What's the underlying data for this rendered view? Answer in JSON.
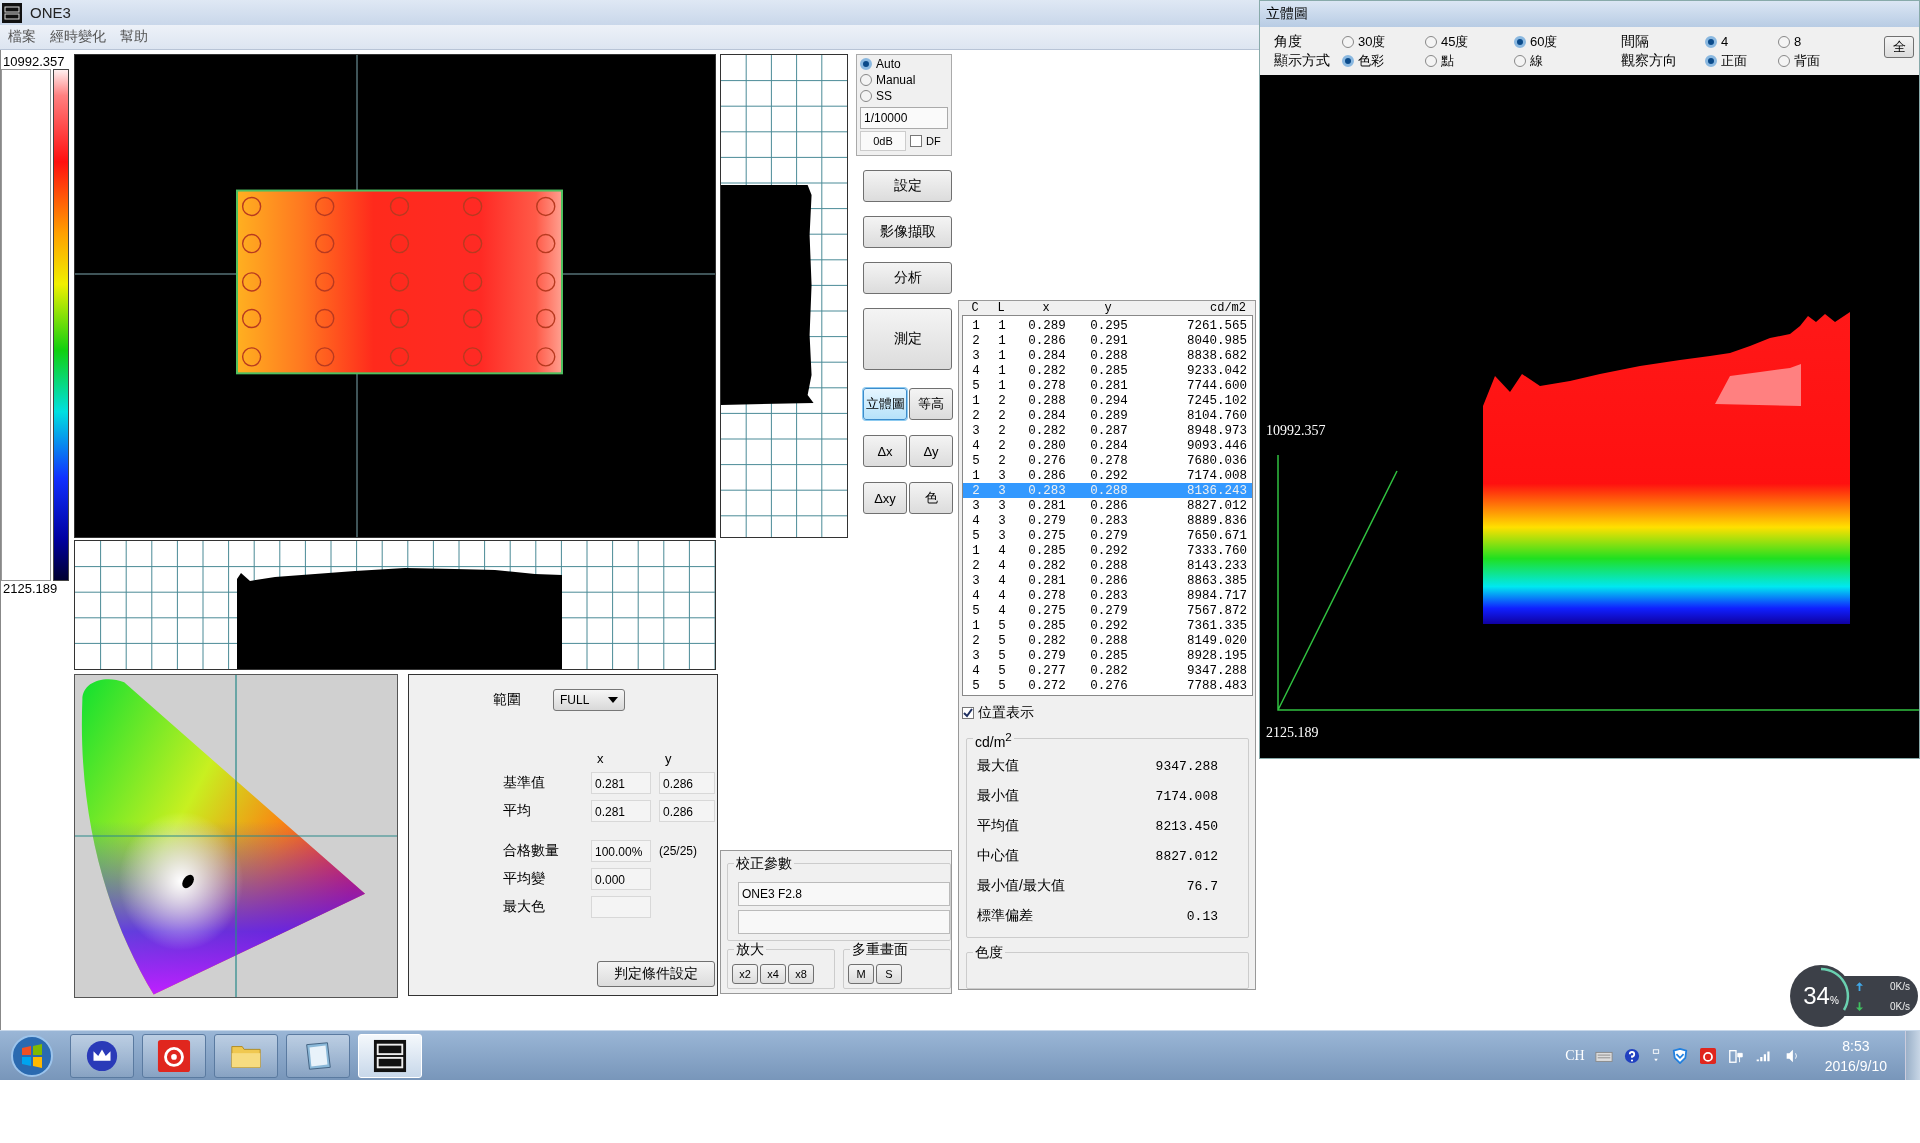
{
  "window": {
    "title": "ONE3"
  },
  "menu": [
    "檔案",
    "經時變化",
    "幫助"
  ],
  "color_scale": {
    "max": "10992.357",
    "min": "2125.189"
  },
  "camera": {
    "modes": [
      {
        "label": "Auto",
        "selected": true
      },
      {
        "label": "Manual",
        "selected": false
      },
      {
        "label": "SS",
        "selected": false
      }
    ],
    "shutter": "1/10000",
    "gain": "0dB",
    "option": {
      "label": "DF",
      "checked": false
    }
  },
  "actions": [
    "設定",
    "影像擷取",
    "分析",
    "測定"
  ],
  "views": [
    {
      "label": "立體圖",
      "selected": true
    },
    {
      "label": "等高",
      "selected": false
    },
    {
      "label": "Δx",
      "selected": false
    },
    {
      "label": "Δy",
      "selected": false
    },
    {
      "label": "Δxy",
      "selected": false
    },
    {
      "label": "色",
      "selected": false
    }
  ],
  "judgement": {
    "range_label": "範圍",
    "range": "FULL",
    "col_x": "x",
    "col_y": "y",
    "rows": [
      {
        "label": "基準值",
        "values": [
          "0.281",
          "0.286"
        ]
      },
      {
        "label": "平均",
        "values": [
          "0.281",
          "0.286"
        ]
      },
      {
        "label": "合格數量",
        "values": [
          "100.00%"
        ],
        "note": "(25/25)"
      },
      {
        "label": "平均變",
        "values": [
          "0.000"
        ]
      },
      {
        "label": "最大色"
      }
    ],
    "button": "判定條件設定"
  },
  "calibration": {
    "title": "校正參數",
    "value": "ONE3 F2.8",
    "zoom_title": "放大",
    "zoom_buttons": [
      "x2",
      "x4",
      "x8"
    ],
    "multi_title": "多重畫面",
    "multi_buttons": [
      "M",
      "S"
    ]
  },
  "table": {
    "columns": [
      "C",
      "L",
      "x",
      "y",
      "cd/m2"
    ],
    "rows": [
      {
        "cells": [
          "1",
          "1",
          "0.289",
          "0.295",
          "7261.565"
        ],
        "selected": false
      },
      {
        "cells": [
          "2",
          "1",
          "0.286",
          "0.291",
          "8040.985"
        ],
        "selected": false
      },
      {
        "cells": [
          "3",
          "1",
          "0.284",
          "0.288",
          "8838.682"
        ],
        "selected": false
      },
      {
        "cells": [
          "4",
          "1",
          "0.282",
          "0.285",
          "9233.042"
        ],
        "selected": false
      },
      {
        "cells": [
          "5",
          "1",
          "0.278",
          "0.281",
          "7744.600"
        ],
        "selected": false
      },
      {
        "cells": [
          "1",
          "2",
          "0.288",
          "0.294",
          "7245.102"
        ],
        "selected": false
      },
      {
        "cells": [
          "2",
          "2",
          "0.284",
          "0.289",
          "8104.760"
        ],
        "selected": false
      },
      {
        "cells": [
          "3",
          "2",
          "0.282",
          "0.287",
          "8948.973"
        ],
        "selected": false
      },
      {
        "cells": [
          "4",
          "2",
          "0.280",
          "0.284",
          "9093.446"
        ],
        "selected": false
      },
      {
        "cells": [
          "5",
          "2",
          "0.276",
          "0.278",
          "7680.036"
        ],
        "selected": false
      },
      {
        "cells": [
          "1",
          "3",
          "0.286",
          "0.292",
          "7174.008"
        ],
        "selected": false
      },
      {
        "cells": [
          "2",
          "3",
          "0.283",
          "0.288",
          "8136.243"
        ],
        "selected": true
      },
      {
        "cells": [
          "3",
          "3",
          "0.281",
          "0.286",
          "8827.012"
        ],
        "selected": false
      },
      {
        "cells": [
          "4",
          "3",
          "0.279",
          "0.283",
          "8889.836"
        ],
        "selected": false
      },
      {
        "cells": [
          "5",
          "3",
          "0.275",
          "0.279",
          "7650.671"
        ],
        "selected": false
      },
      {
        "cells": [
          "1",
          "4",
          "0.285",
          "0.292",
          "7333.760"
        ],
        "selected": false
      },
      {
        "cells": [
          "2",
          "4",
          "0.282",
          "0.288",
          "8143.233"
        ],
        "selected": false
      },
      {
        "cells": [
          "3",
          "4",
          "0.281",
          "0.286",
          "8863.385"
        ],
        "selected": false
      },
      {
        "cells": [
          "4",
          "4",
          "0.278",
          "0.283",
          "8984.717"
        ],
        "selected": false
      },
      {
        "cells": [
          "5",
          "4",
          "0.275",
          "0.279",
          "7567.872"
        ],
        "selected": false
      },
      {
        "cells": [
          "1",
          "5",
          "0.285",
          "0.292",
          "7361.335"
        ],
        "selected": false
      },
      {
        "cells": [
          "2",
          "5",
          "0.282",
          "0.288",
          "8149.020"
        ],
        "selected": false
      },
      {
        "cells": [
          "3",
          "5",
          "0.279",
          "0.285",
          "8928.195"
        ],
        "selected": false
      },
      {
        "cells": [
          "4",
          "5",
          "0.277",
          "0.282",
          "9347.288"
        ],
        "selected": false
      },
      {
        "cells": [
          "5",
          "5",
          "0.272",
          "0.276",
          "7788.483"
        ],
        "selected": false
      }
    ]
  },
  "show_positions": {
    "label": "位置表示",
    "checked": true
  },
  "stats": {
    "title": "cd/m$^{2}$",
    "rows": [
      {
        "label": "最大值",
        "value": "9347.288"
      },
      {
        "label": "最小值",
        "value": "7174.008"
      },
      {
        "label": "平均值",
        "value": "8213.450"
      },
      {
        "label": "中心值",
        "value": "8827.012"
      },
      {
        "label": "最小值/最大值",
        "value": "76.7"
      },
      {
        "label": "標準偏差",
        "value": "0.13"
      }
    ]
  },
  "chroma": {
    "title": "色度"
  },
  "view3d": {
    "title": "立體圖",
    "button": "全",
    "axis_max": "10992.357",
    "axis_min": "2125.189",
    "rows": [
      {
        "groups": [
          {
            "label": "角度",
            "options": [
              {
                "label": "30度",
                "selected": false
              },
              {
                "label": "45度",
                "selected": false
              },
              {
                "label": "60度",
                "selected": true
              }
            ]
          },
          {
            "label": "間隔",
            "options": [
              {
                "label": "4",
                "selected": true
              },
              {
                "label": "8",
                "selected": false
              }
            ]
          }
        ]
      },
      {
        "groups": [
          {
            "label": "顯示方式",
            "options": [
              {
                "label": "色彩",
                "selected": true
              },
              {
                "label": "點",
                "selected": false
              },
              {
                "label": "線",
                "selected": false
              }
            ]
          },
          {
            "label": "觀察方向",
            "options": [
              {
                "label": "正面",
                "selected": true
              },
              {
                "label": "背面",
                "selected": false
              }
            ]
          }
        ]
      }
    ]
  },
  "net_monitor": {
    "percent": "34",
    "unit": "%",
    "upload": "0K/s",
    "download": "0K/s"
  },
  "taskbar": {
    "apps": [
      {
        "kind": "crown",
        "active": false
      },
      {
        "kind": "spiral",
        "active": false
      },
      {
        "kind": "folder",
        "active": false
      },
      {
        "kind": "notebook",
        "active": false
      },
      {
        "kind": "logo",
        "active": true
      }
    ],
    "language": "CH",
    "time": "8:53",
    "date": "2016/9/10"
  }
}
